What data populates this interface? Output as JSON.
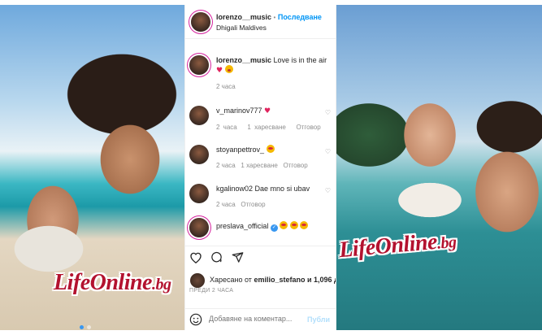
{
  "colors": {
    "accent": "#0095f6",
    "watermark": "#b3122f",
    "muted": "#8e8e8e",
    "text": "#262626"
  },
  "watermark": {
    "left": "LifeOnline",
    "left_suffix": ".bg",
    "right": "LifeOnline",
    "right_suffix": ".bg"
  },
  "header": {
    "username": "lorenzo__music",
    "separator": "•",
    "follow_label": "Последване",
    "location": "Dhigali Maldives"
  },
  "caption": {
    "username": "lorenzo__music",
    "text": "Love is in the air",
    "emojis": [
      "heart",
      "face-blowing-kiss"
    ],
    "time": "2 часа"
  },
  "comments": [
    {
      "username": "v_marinov777",
      "text": "",
      "emojis": [
        "heart"
      ],
      "time": "2 часа",
      "likes": "1 харесване",
      "reply": "Отговор"
    },
    {
      "username": "stoyanpettrov_",
      "text": "",
      "emojis": [
        "smiling-face-with-heart-eyes"
      ],
      "time": "2 часа",
      "likes": "1 харесване",
      "reply": "Отговор"
    },
    {
      "username": "kgalinow02",
      "text": "Dae mno si ubav",
      "emojis": [],
      "time": "2 часа",
      "likes": "",
      "reply": "Отговор"
    },
    {
      "username": "preslava_official",
      "text": "",
      "emojis": [
        "smiling-face-with-heart-eyes",
        "smiling-face-with-heart-eyes",
        "smiling-face-with-heart-eyes"
      ],
      "verified": true
    }
  ],
  "actions": {
    "like_icon": "heart-outline-icon",
    "comment_icon": "comment-icon",
    "share_icon": "share-icon",
    "save_icon": "bookmark-icon"
  },
  "liked_by": {
    "prefix": "Харесано от",
    "user": "emilio_stefano",
    "suffix": "и 1,096 д"
  },
  "time_ago": "ПРЕДИ 2 ЧАСА",
  "comment_box": {
    "placeholder": "Добавяне на коментар...",
    "post_label": "Публи"
  }
}
